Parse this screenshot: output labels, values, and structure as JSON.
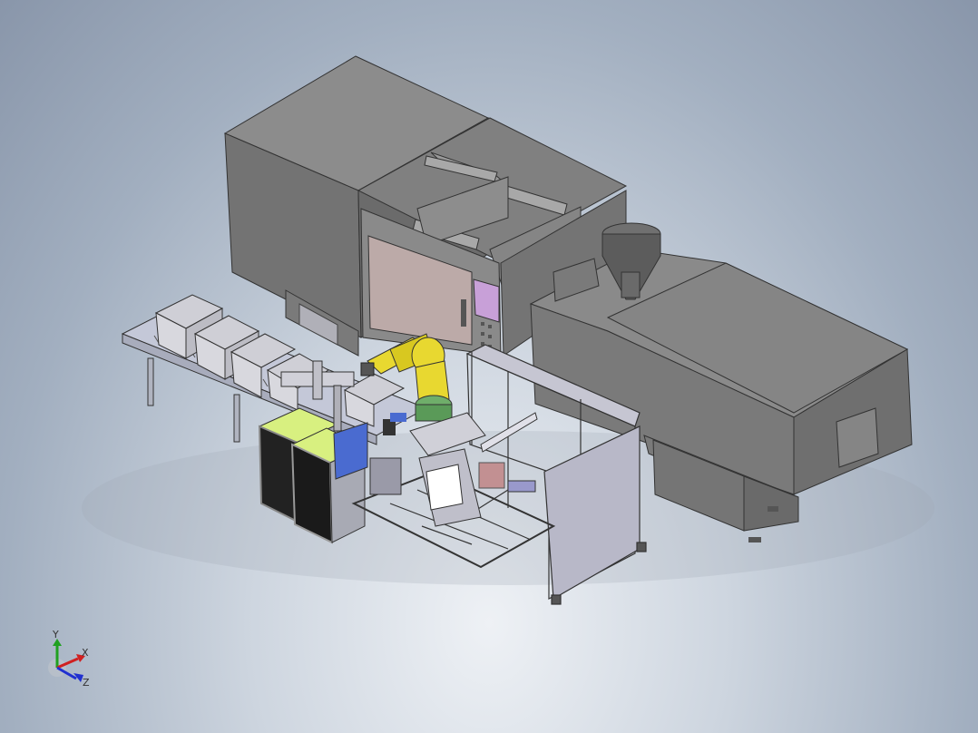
{
  "viewport": {
    "background_center": "#eef1f5",
    "background_edge": "#8996aa"
  },
  "triad": {
    "x_label": "X",
    "y_label": "Y",
    "z_label": "Z",
    "x_color": "#d02020",
    "y_color": "#20a020",
    "z_color": "#2030d0"
  },
  "model": {
    "machine_color": "#7f7f7f",
    "robot_color": "#e8d830",
    "display_color": "#d8f080",
    "window_color": "#bcaaa8",
    "panel_color": "#c8a0d8"
  }
}
